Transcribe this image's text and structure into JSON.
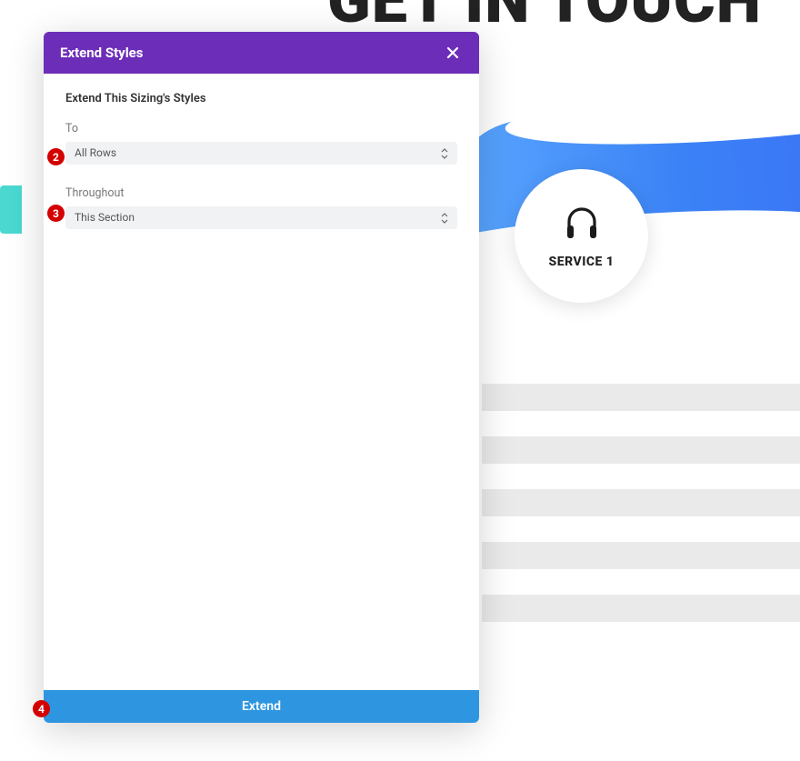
{
  "background": {
    "page_title_fragment": "GET IN TOUCH",
    "service": {
      "label": "SERVICE 1"
    }
  },
  "modal": {
    "title": "Extend Styles",
    "heading": "Extend This Sizing's Styles",
    "fields": {
      "to": {
        "label": "To",
        "value": "All Rows"
      },
      "throughout": {
        "label": "Throughout",
        "value": "This Section"
      }
    },
    "button_label": "Extend"
  },
  "badges": {
    "b2": "2",
    "b3": "3",
    "b4": "4"
  }
}
